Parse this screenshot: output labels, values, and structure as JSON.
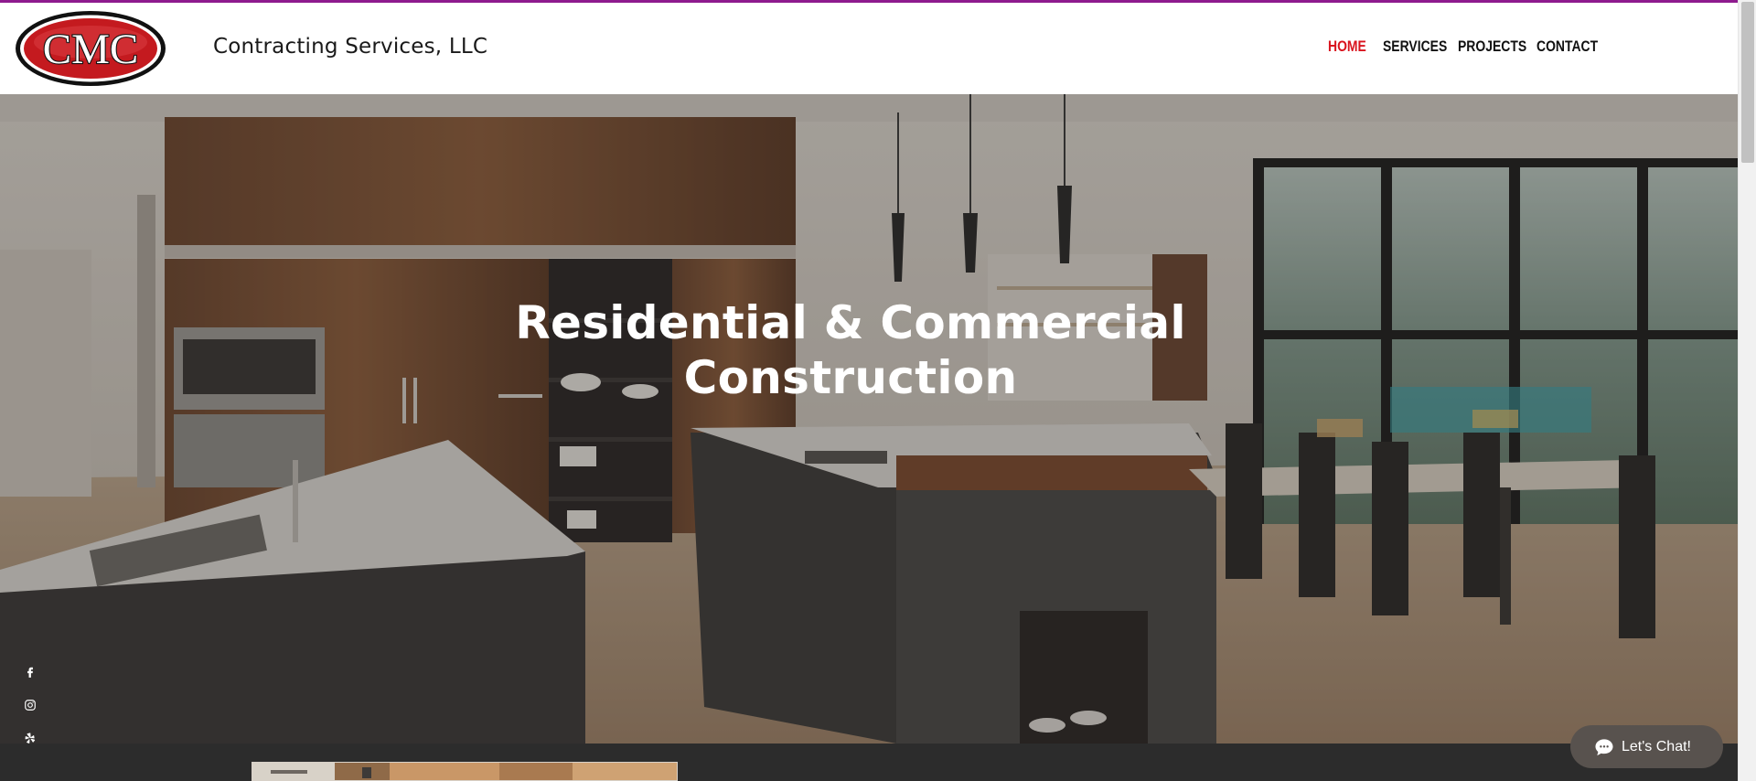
{
  "header": {
    "logo_text": "CMC",
    "brand_name": "Contracting Services, LLC",
    "nav": [
      {
        "label": "HOME",
        "active": true
      },
      {
        "label": "SERVICES",
        "active": false
      },
      {
        "label": "PROJECTS",
        "active": false
      },
      {
        "label": "CONTACT",
        "active": false
      }
    ]
  },
  "hero": {
    "title_line1": "Residential & Commercial",
    "title_line2": "Construction"
  },
  "social": {
    "icons": [
      "facebook-icon",
      "instagram-icon",
      "yelp-icon"
    ]
  },
  "chat": {
    "label": "Let's Chat!",
    "icon": "chat-bubble-icon"
  },
  "colors": {
    "accent_line": "#8e1b8e",
    "nav_active": "#d9141e",
    "nav_default": "#111111",
    "band": "#2c2c2c",
    "chat_bg": "#58524e"
  }
}
